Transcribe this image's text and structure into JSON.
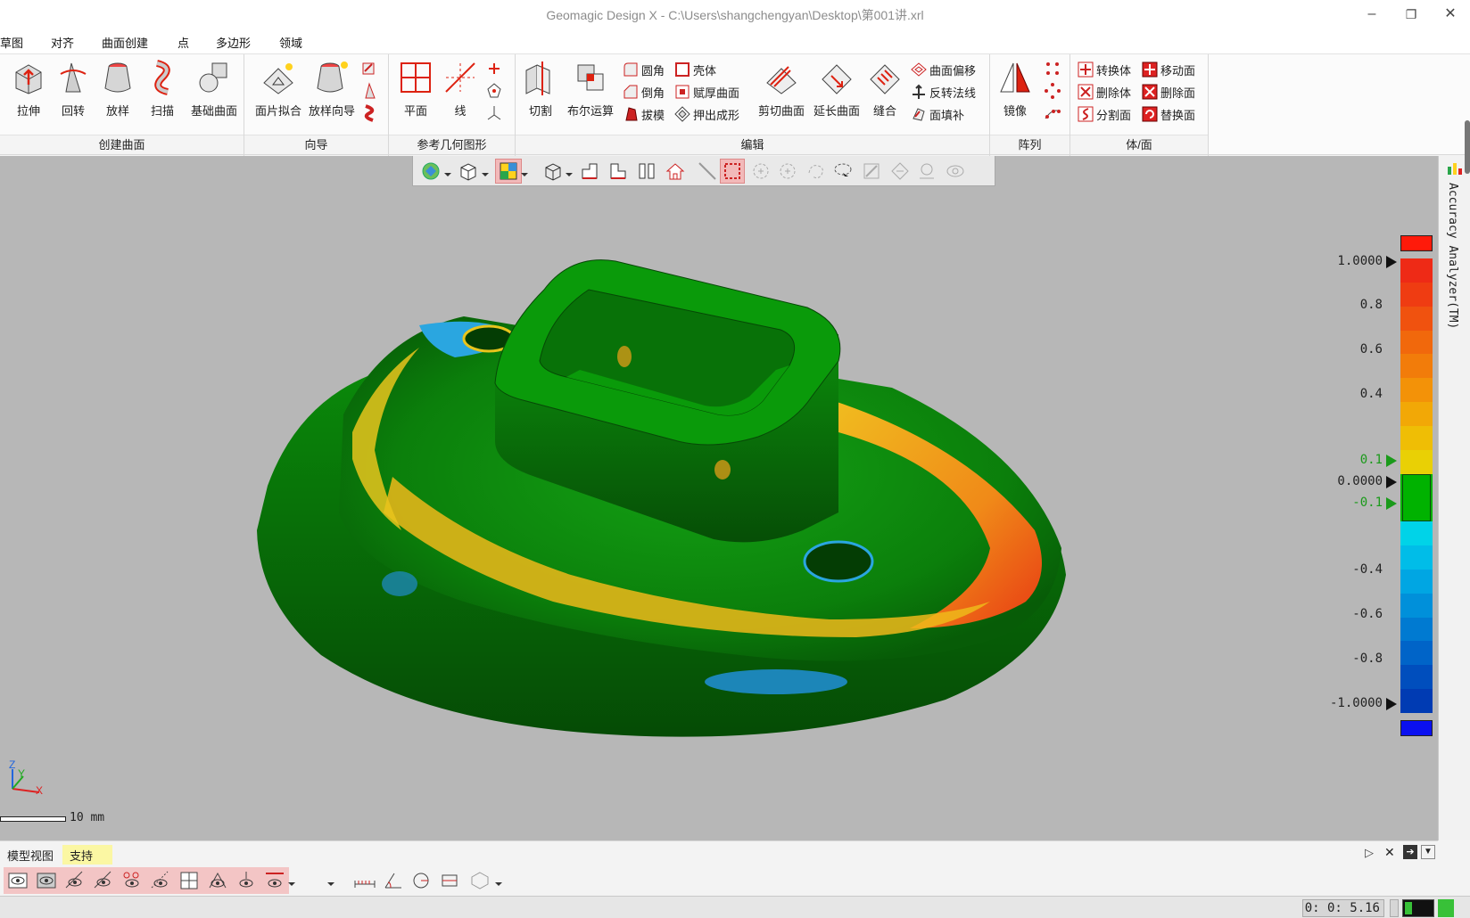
{
  "window": {
    "title": "Geomagic Design X - C:\\Users\\shangchengyan\\Desktop\\第001讲.xrl",
    "controls": {
      "minimize": "–",
      "restore": "❐",
      "close": "✕"
    }
  },
  "menu": {
    "items": [
      "草图",
      "对齐",
      "曲面创建",
      "点",
      "多边形",
      "领域"
    ]
  },
  "ribbon": {
    "groups": {
      "create_surface": {
        "label": "创建曲面",
        "buttons": [
          "拉伸",
          "回转",
          "放样",
          "扫描",
          "基础曲面"
        ]
      },
      "wizard": {
        "label": "向导",
        "buttons": [
          "面片拟合",
          "放样向导"
        ]
      },
      "ref_geometry": {
        "label": "参考几何图形",
        "buttons": [
          "平面",
          "线"
        ]
      },
      "edit": {
        "label": "编辑",
        "buttons": [
          "切割",
          "布尔运算",
          "剪切曲面",
          "延长曲面",
          "缝合"
        ],
        "small": [
          "圆角",
          "壳体",
          "倒角",
          "赋厚曲面",
          "拔模",
          "押出成形",
          "曲面偏移",
          "反转法线",
          "面填补"
        ]
      },
      "pattern": {
        "label": "阵列",
        "buttons": [
          "镜像"
        ]
      },
      "body_face": {
        "label": "体/面",
        "small": [
          "转换体",
          "移动面",
          "删除体",
          "删除面",
          "分割面",
          "替换面"
        ]
      }
    }
  },
  "viewport": {
    "scale_label": "10 mm",
    "axis_labels": {
      "x": "X",
      "y": "Y",
      "z": "Z"
    },
    "legend": {
      "ticks": [
        "1.0000",
        "0.8",
        "0.6",
        "0.4",
        "0.1",
        "0.0000",
        "-0.1",
        "-0.4",
        "-0.6",
        "-0.8",
        "-1.0000"
      ],
      "colors": [
        "#ee2a16",
        "#ef3c12",
        "#f0520f",
        "#f1680c",
        "#f27c0a",
        "#f39208",
        "#f2a806",
        "#efbe05",
        "#e9d005",
        "#00b200",
        "#00b200",
        "#00d3e8",
        "#00bde8",
        "#00a6e3",
        "#0090da",
        "#007ad1",
        "#0064c8",
        "#004ebd",
        "#003bb3"
      ],
      "over_color": "#ff1a0a",
      "under_color": "#0a10f0"
    }
  },
  "side_panel": {
    "title": "Accuracy Analyzer(TM)"
  },
  "bottom_tabs": [
    "模型视图",
    "支持"
  ],
  "status": {
    "time": "0: 0: 5.16"
  }
}
